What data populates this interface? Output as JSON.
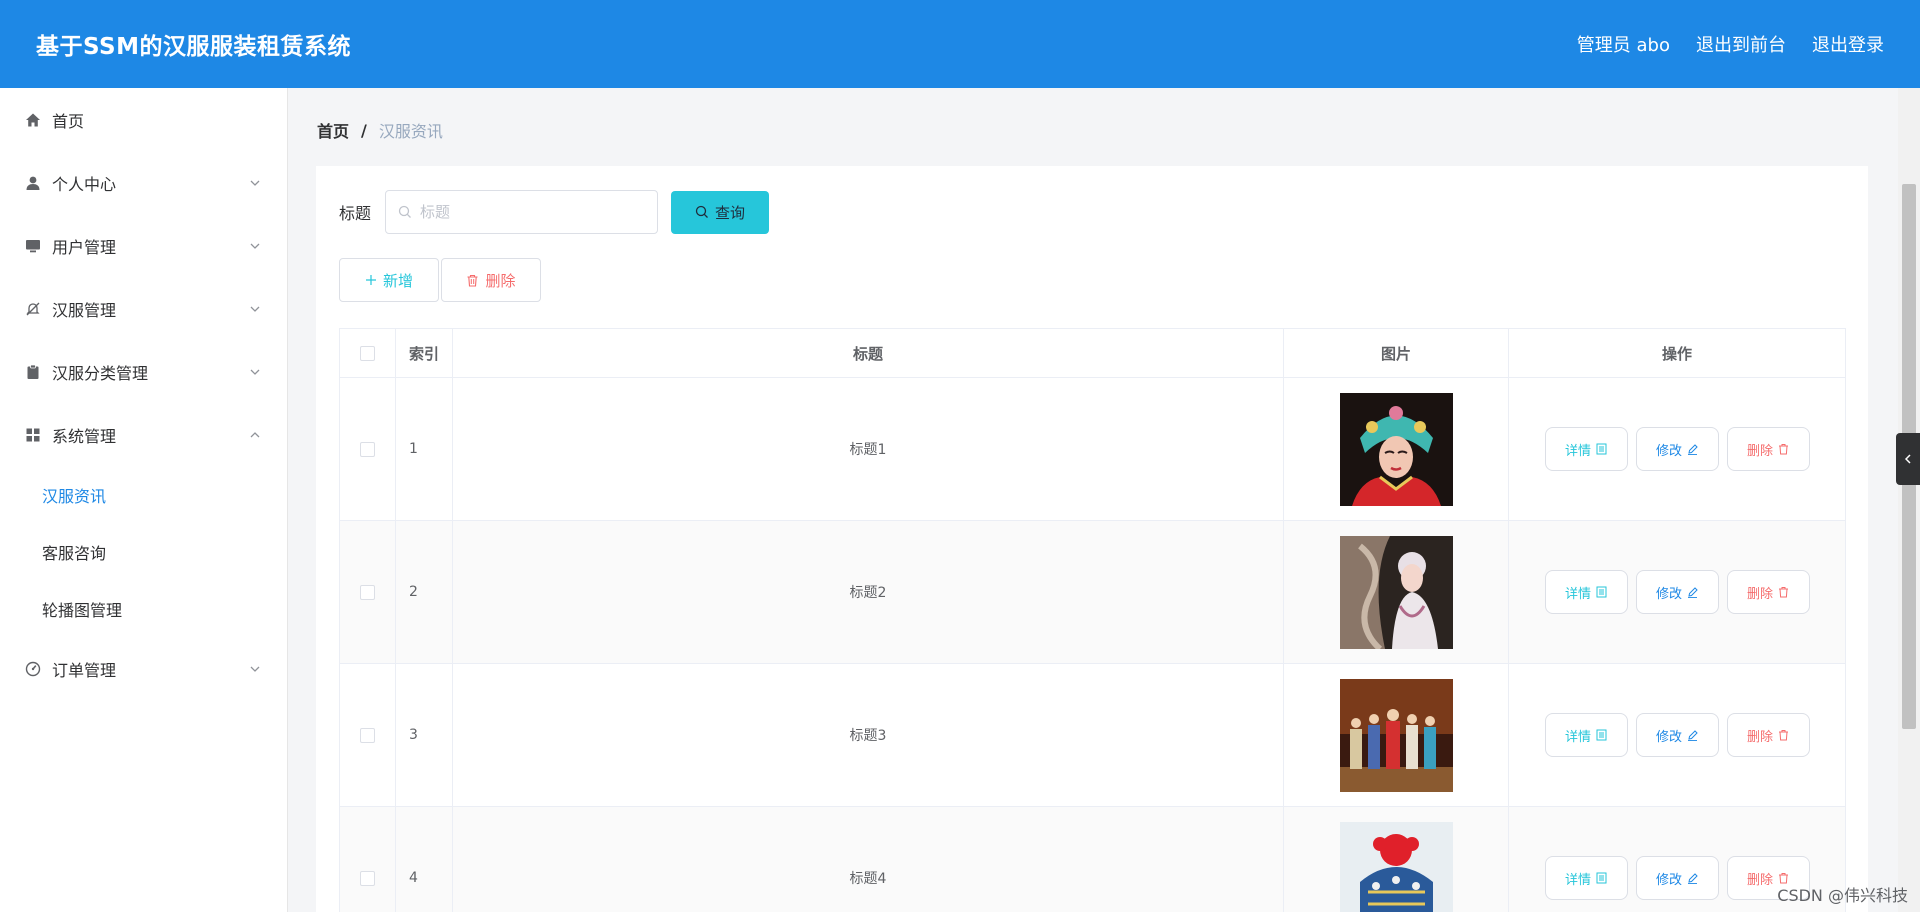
{
  "header": {
    "title": "基于SSM的汉服服装租赁系统",
    "user": "管理员 abo",
    "front_link": "退出到前台",
    "logout_link": "退出登录"
  },
  "sidebar": {
    "items": [
      {
        "label": "首页",
        "icon": "home-icon"
      },
      {
        "label": "个人中心",
        "icon": "user-icon"
      },
      {
        "label": "用户管理",
        "icon": "monitor-icon"
      },
      {
        "label": "汉服管理",
        "icon": "bell-off-icon"
      },
      {
        "label": "汉服分类管理",
        "icon": "clipboard-icon"
      },
      {
        "label": "系统管理",
        "icon": "grid-icon"
      },
      {
        "label": "订单管理",
        "icon": "gauge-icon"
      }
    ],
    "submenu": [
      {
        "label": "汉服资讯",
        "active": true
      },
      {
        "label": "客服咨询",
        "active": false
      },
      {
        "label": "轮播图管理",
        "active": false
      }
    ]
  },
  "breadcrumb": {
    "home": "首页",
    "separator": "/",
    "current": "汉服资讯"
  },
  "search": {
    "label": "标题",
    "placeholder": "标题",
    "value": "",
    "button": "查询"
  },
  "actions": {
    "add": "新增",
    "delete": "删除"
  },
  "table": {
    "columns": [
      "索引",
      "标题",
      "图片",
      "操作"
    ],
    "rows": [
      {
        "index": "1",
        "title": "标题1"
      },
      {
        "index": "2",
        "title": "标题2"
      },
      {
        "index": "3",
        "title": "标题3"
      },
      {
        "index": "4",
        "title": "标题4"
      }
    ],
    "row_actions": {
      "detail": "详情",
      "edit": "修改",
      "delete": "删除"
    }
  },
  "watermark": "CSDN @伟兴科技",
  "colors": {
    "header": "#1e88e5",
    "accent": "#26c6da",
    "danger": "#f56c6c"
  }
}
